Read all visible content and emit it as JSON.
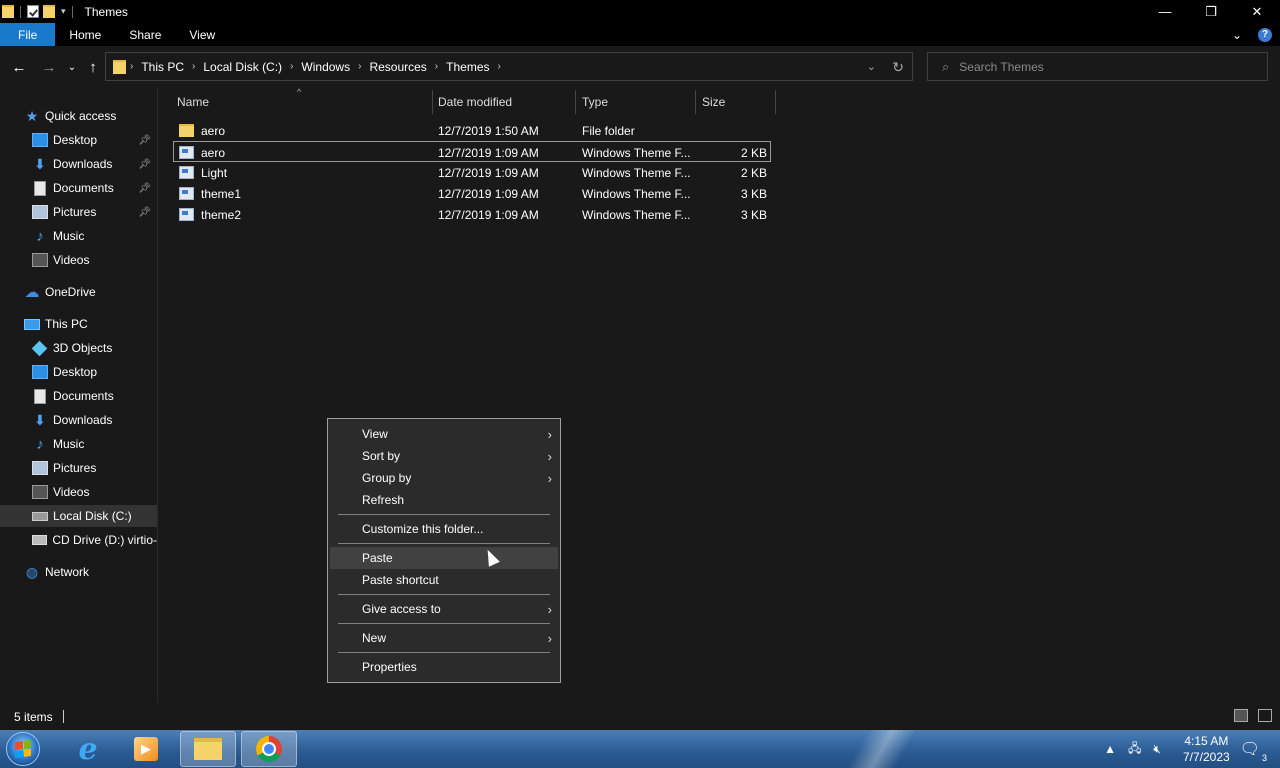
{
  "window": {
    "title": "Themes",
    "controls": {
      "minimize": "—",
      "restore": "❐",
      "close": "✕"
    }
  },
  "ribbon": {
    "tabs": [
      "File",
      "Home",
      "Share",
      "View"
    ]
  },
  "address": {
    "crumbs": [
      "This PC",
      "Local Disk (C:)",
      "Windows",
      "Resources",
      "Themes"
    ],
    "search_placeholder": "Search Themes"
  },
  "nav": {
    "items": [
      {
        "label": "Quick access",
        "icon": "star-icon"
      },
      {
        "label": "Desktop",
        "icon": "desktop-icon",
        "pinned": true
      },
      {
        "label": "Downloads",
        "icon": "download-icon",
        "pinned": true
      },
      {
        "label": "Documents",
        "icon": "documents-icon",
        "pinned": true
      },
      {
        "label": "Pictures",
        "icon": "pictures-icon",
        "pinned": true
      },
      {
        "label": "Music",
        "icon": "music-icon"
      },
      {
        "label": "Videos",
        "icon": "videos-icon"
      },
      {
        "label": "OneDrive",
        "icon": "cloud-icon"
      },
      {
        "label": "This PC",
        "icon": "computer-icon"
      },
      {
        "label": "3D Objects",
        "icon": "cube-icon"
      },
      {
        "label": "Desktop",
        "icon": "desktop-icon"
      },
      {
        "label": "Documents",
        "icon": "documents-icon"
      },
      {
        "label": "Downloads",
        "icon": "download-icon"
      },
      {
        "label": "Music",
        "icon": "music-icon"
      },
      {
        "label": "Pictures",
        "icon": "pictures-icon"
      },
      {
        "label": "Videos",
        "icon": "videos-icon"
      },
      {
        "label": "Local Disk (C:)",
        "icon": "disk-icon",
        "selected": true
      },
      {
        "label": "CD Drive (D:) virtio-",
        "icon": "cd-drive-icon"
      },
      {
        "label": "Network",
        "icon": "network-icon"
      }
    ]
  },
  "columns": {
    "name": "Name",
    "date": "Date modified",
    "type": "Type",
    "size": "Size"
  },
  "files": [
    {
      "name": "aero",
      "date": "12/7/2019 1:50 AM",
      "type": "File folder",
      "size": "",
      "kind": "folder"
    },
    {
      "name": "aero",
      "date": "12/7/2019 1:09 AM",
      "type": "Windows Theme F...",
      "size": "2 KB",
      "kind": "theme",
      "selected": true
    },
    {
      "name": "Light",
      "date": "12/7/2019 1:09 AM",
      "type": "Windows Theme F...",
      "size": "2 KB",
      "kind": "theme"
    },
    {
      "name": "theme1",
      "date": "12/7/2019 1:09 AM",
      "type": "Windows Theme F...",
      "size": "3 KB",
      "kind": "theme"
    },
    {
      "name": "theme2",
      "date": "12/7/2019 1:09 AM",
      "type": "Windows Theme F...",
      "size": "3 KB",
      "kind": "theme"
    }
  ],
  "context_menu": {
    "items": [
      {
        "label": "View",
        "submenu": true
      },
      {
        "label": "Sort by",
        "submenu": true
      },
      {
        "label": "Group by",
        "submenu": true
      },
      {
        "label": "Refresh"
      },
      {
        "label": "Customize this folder..."
      },
      {
        "label": "Paste",
        "hover": true
      },
      {
        "label": "Paste shortcut"
      },
      {
        "label": "Give access to",
        "submenu": true
      },
      {
        "label": "New",
        "submenu": true
      },
      {
        "label": "Properties"
      }
    ]
  },
  "status": {
    "text": "5 items"
  },
  "taskbar": {
    "clock_time": "4:15 AM",
    "clock_date": "7/7/2023",
    "notification_count": "3"
  },
  "colors": {
    "background": "#191919",
    "file_tab": "#1979ca",
    "menu_bg": "#2b2b2b",
    "menu_hover": "#414141"
  }
}
